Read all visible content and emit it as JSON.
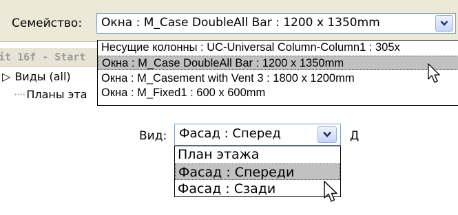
{
  "toolbar": {
    "family_label": "Семейство:",
    "family_value": "Окна : M_Case DoubleAll Bar : 1200 x 1350mm"
  },
  "family_dropdown": {
    "items": [
      "Несущие колонны : UC-Universal Column-Column1 : 305x",
      "Окна : M_Case DoubleAll Bar : 1200 x 1350mm",
      "Окна : M_Casement with Vent 3 : 1800 x 1200mm",
      "Окна : M_Fixed1 : 600 x 600mm"
    ],
    "selected_index": 1
  },
  "tree": {
    "caption": "it 16f - Start",
    "views_label": "Виды (all)",
    "views_expander": "▷",
    "plans_label": "Планы эта"
  },
  "view_selector": {
    "label": "Вид:",
    "value": "Фасад : Сперед",
    "next_label": "Д"
  },
  "view_dropdown": {
    "items": [
      "План этажа",
      "Фасад : Спереди",
      "Фасад : Сзади"
    ],
    "selected_index": 1
  },
  "colors": {
    "toolbar_bg": "#ece9d8",
    "combo_border": "#7f9db9",
    "selection_bg": "#c1c1c1"
  },
  "icons": {
    "dropdown_arrow": "chevron-down-icon",
    "cursor": "mouse-pointer-icon"
  }
}
